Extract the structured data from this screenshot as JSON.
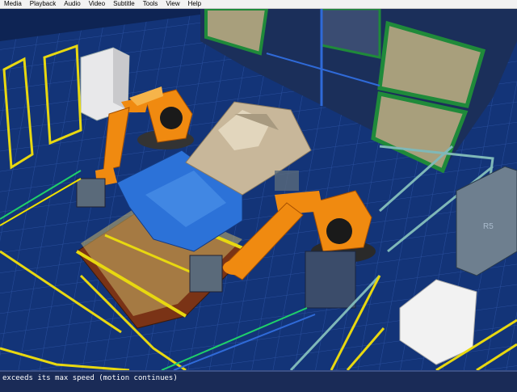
{
  "menubar": {
    "items": [
      "Media",
      "Playback",
      "Audio",
      "Video",
      "Subtitle",
      "Tools",
      "View",
      "Help"
    ]
  },
  "status": {
    "message": "exceeds its max speed (motion continues)"
  },
  "scene": {
    "robot_panel_label": "R5",
    "colors": {
      "floor": "#133478",
      "robot": "#f08a10",
      "fixture_yellow": "#e8d810",
      "window_frame": "#1f8a3a",
      "car_body": "#c8b79a"
    }
  }
}
